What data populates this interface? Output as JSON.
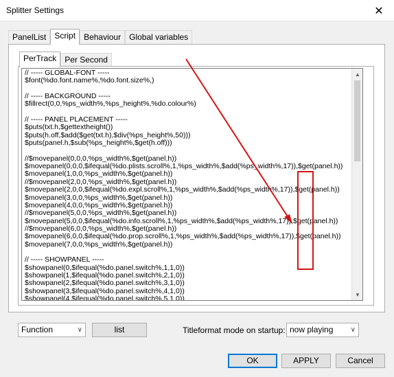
{
  "window": {
    "title": "Splitter Settings",
    "close_glyph": "✕"
  },
  "tabs_outer": [
    "PanelList",
    "Script",
    "Behaviour",
    "Global variables"
  ],
  "tabs_inner": [
    "PerTrack",
    "Per Second"
  ],
  "editor": {
    "lines": [
      "// ----- GLOBAL-FONT -----",
      "$font(%do.font.name%,%do.font.size%,)",
      "",
      "// ----- BACKGROUND -----",
      "$fillrect(0,0,%ps_width%,%ps_height%,%do.colour%)",
      "",
      "// ----- PANEL PLACEMENT -----",
      "$puts(txt.h,$gettextheight())",
      "$puts(h.off,$add($get(txt.h),$div(%ps_height%,50)))",
      "$puts(panel.h,$sub(%ps_height%,$get(h.off)))",
      "",
      "//$movepanel(0,0,0,%ps_width%,$get(panel.h))",
      "$movepanel(0,0,0,$ifequal(%do.plists.scroll%,1,%ps_width%,$add(%ps_width%,17)),$get(panel.h))",
      "$movepanel(1,0,0,%ps_width%,$get(panel.h))",
      "//$movepanel(2,0,0,%ps_width%,$get(panel.h))",
      "$movepanel(2,0,0,$ifequal(%do.expl.scroll%,1,%ps_width%,$add(%ps_width%,17)),$get(panel.h))",
      "$movepanel(3,0,0,%ps_width%,$get(panel.h))",
      "$movepanel(4,0,0,%ps_width%,$get(panel.h))",
      "//$movepanel(5,0,0,%ps_width%,$get(panel.h))",
      "$movepanel(5,0,0,$ifequal(%do.info.scroll%,1,%ps_width%,$add(%ps_width%,17)),$get(panel.h))",
      "//$movepanel(6,0,0,%ps_width%,$get(panel.h))",
      "$movepanel(6,0,0,$ifequal(%do.prop.scroll%,1,%ps_width%,$add(%ps_width%,17)),$get(panel.h))",
      "$movepanel(7,0,0,%ps_width%,$get(panel.h))",
      "",
      "// ----- SHOWPANEL -----",
      "$showpanel(0,$ifequal(%do.panel.switch%,1,1,0))",
      "$showpanel(1,$ifequal(%do.panel.switch%,2,1,0))",
      "$showpanel(2,$ifequal(%do.panel.switch%,3,1,0))",
      "$showpanel(3,$ifequal(%do.panel.switch%,4,1,0))",
      "$showpanel(4,$ifequal(%do.panel.switch%,5,1,0))"
    ]
  },
  "bottom_controls": {
    "function_select": "Function",
    "list_button": "list",
    "titleformat_label": "Titleformat mode on startup:",
    "titleformat_select": "now playing"
  },
  "dialog_buttons": {
    "ok": "OK",
    "apply": "APPLY",
    "cancel": "Cancel"
  },
  "annotation_color": "#d41414"
}
